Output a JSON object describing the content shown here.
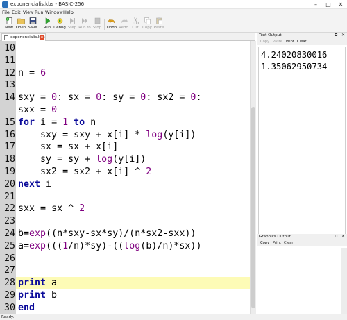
{
  "window": {
    "title": "exponencialis.kbs - BASIC-256"
  },
  "menu": {
    "items": [
      "File",
      "Edit",
      "View",
      "Run",
      "Window",
      "Help"
    ]
  },
  "toolbar": {
    "buttons": [
      {
        "label": "New",
        "icon": "new-file-icon",
        "disabled": false
      },
      {
        "label": "Open",
        "icon": "open-folder-icon",
        "disabled": false
      },
      {
        "label": "Save",
        "icon": "save-disk-icon",
        "disabled": false
      },
      {
        "label": "Run",
        "icon": "run-play-icon",
        "disabled": false
      },
      {
        "label": "Debug",
        "icon": "debug-icon",
        "disabled": false
      },
      {
        "label": "Step",
        "icon": "step-icon",
        "disabled": true
      },
      {
        "label": "Run to",
        "icon": "run-to-icon",
        "disabled": true
      },
      {
        "label": "Stop",
        "icon": "stop-icon",
        "disabled": true
      },
      {
        "label": "Undo",
        "icon": "undo-icon",
        "disabled": false
      },
      {
        "label": "Redo",
        "icon": "redo-icon",
        "disabled": true
      },
      {
        "label": "Cut",
        "icon": "cut-icon",
        "disabled": true
      },
      {
        "label": "Copy",
        "icon": "copy-icon",
        "disabled": true
      },
      {
        "label": "Paste",
        "icon": "paste-icon",
        "disabled": true
      }
    ]
  },
  "tab": {
    "name": "exponencialis.kbs",
    "close": "x"
  },
  "editor": {
    "highlight_line": 28,
    "lines": [
      {
        "n": "10",
        "code": ""
      },
      {
        "n": "11",
        "code": ""
      },
      {
        "n": "12",
        "code": "n = 6"
      },
      {
        "n": "13",
        "code": ""
      },
      {
        "n": "14",
        "code": "sxy = 0: sx = 0: sy = 0: sx2 = 0:"
      },
      {
        "n": "",
        "code": "sxx = 0"
      },
      {
        "n": "15",
        "code": "for i = 1 to n"
      },
      {
        "n": "16",
        "code": "    sxy = sxy + x[i] * log(y[i])"
      },
      {
        "n": "17",
        "code": "    sx = sx + x[i]"
      },
      {
        "n": "18",
        "code": "    sy = sy + log(y[i])"
      },
      {
        "n": "19",
        "code": "    sx2 = sx2 + x[i] ^ 2"
      },
      {
        "n": "20",
        "code": "next i"
      },
      {
        "n": "21",
        "code": ""
      },
      {
        "n": "22",
        "code": "sxx = sx ^ 2"
      },
      {
        "n": "23",
        "code": ""
      },
      {
        "n": "24",
        "code": "b=exp((n*sxy-sx*sy)/(n*sx2-sxx))"
      },
      {
        "n": "25",
        "code": "a=exp(((1/n)*sy)-((log(b)/n)*sx))"
      },
      {
        "n": "26",
        "code": ""
      },
      {
        "n": "27",
        "code": ""
      },
      {
        "n": "28",
        "code": "print a"
      },
      {
        "n": "29",
        "code": "print b"
      },
      {
        "n": "30",
        "code": "end"
      }
    ]
  },
  "text_output": {
    "title": "Text Output",
    "buttons": [
      {
        "label": "Copy",
        "disabled": true
      },
      {
        "label": "Paste",
        "disabled": true
      },
      {
        "label": "Print",
        "disabled": false
      },
      {
        "label": "Clear",
        "disabled": false
      }
    ],
    "lines": [
      "4.24020830016",
      "1.35062950734"
    ]
  },
  "graphics_output": {
    "title": "Graphics Output",
    "buttons": [
      {
        "label": "Copy",
        "disabled": false
      },
      {
        "label": "Print",
        "disabled": false
      },
      {
        "label": "Clear",
        "disabled": false
      }
    ]
  },
  "status": {
    "text": "Ready."
  },
  "colors": {
    "keyword": "#0b0b9a",
    "function": "#800080",
    "highlight": "#fdfbb6",
    "gutter": "#d3d3d3"
  }
}
